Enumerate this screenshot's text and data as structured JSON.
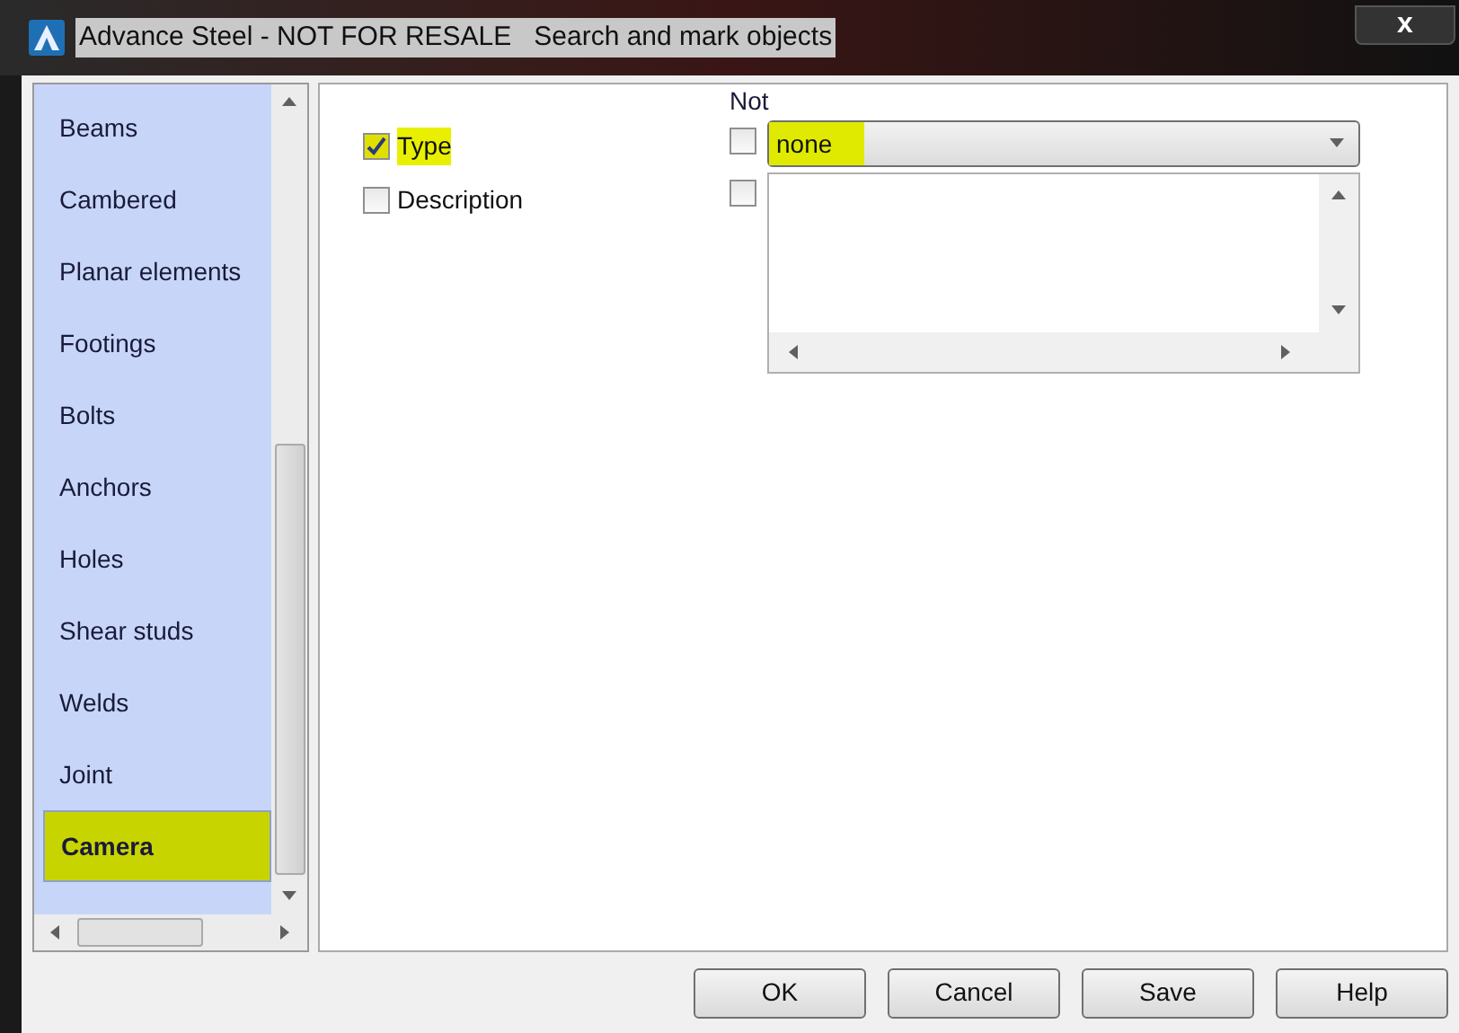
{
  "window": {
    "title": "Advance Steel - NOT FOR RESALE   Search and mark objects",
    "close": "x"
  },
  "sidebar": {
    "items": [
      {
        "label": "Beams",
        "selected": false,
        "highlighted": false
      },
      {
        "label": "Cambered",
        "selected": false,
        "highlighted": false
      },
      {
        "label": "Planar elements",
        "selected": false,
        "highlighted": false
      },
      {
        "label": "Footings",
        "selected": false,
        "highlighted": false
      },
      {
        "label": "Bolts",
        "selected": false,
        "highlighted": false
      },
      {
        "label": "Anchors",
        "selected": false,
        "highlighted": false
      },
      {
        "label": "Holes",
        "selected": false,
        "highlighted": false
      },
      {
        "label": "Shear studs",
        "selected": false,
        "highlighted": false
      },
      {
        "label": "Welds",
        "selected": false,
        "highlighted": false
      },
      {
        "label": "Joint",
        "selected": false,
        "highlighted": false
      },
      {
        "label": "Camera",
        "selected": true,
        "highlighted": true
      }
    ]
  },
  "not_label": "Not",
  "criteria": [
    {
      "kind": "dropdown",
      "label": "Type",
      "checked": true,
      "highlighted": true,
      "not_checked": false,
      "value": "none",
      "value_highlighted": true
    },
    {
      "kind": "list",
      "label": "Description",
      "checked": false,
      "highlighted": false,
      "not_checked": false
    }
  ],
  "buttons": [
    "OK",
    "Cancel",
    "Save",
    "Help"
  ]
}
